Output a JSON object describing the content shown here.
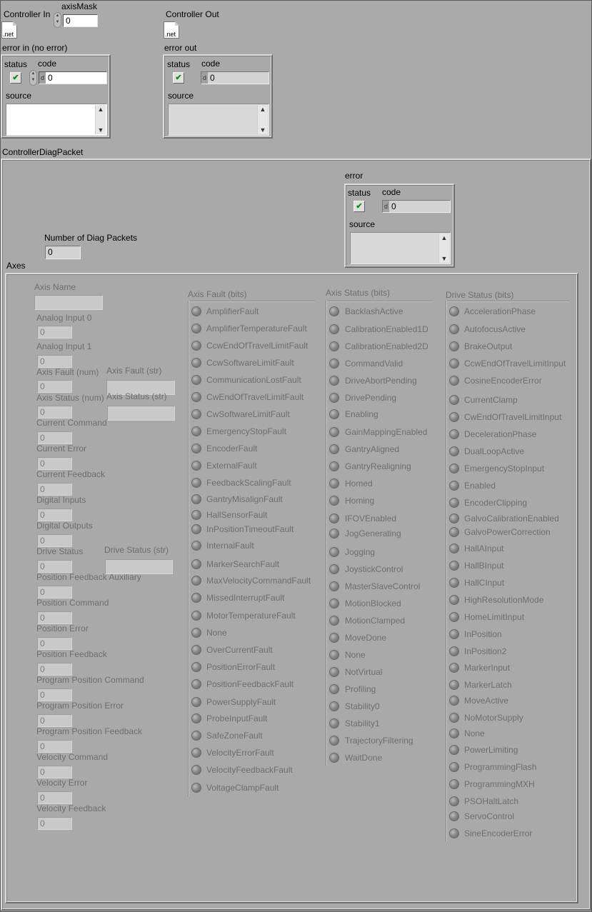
{
  "controller_in": {
    "label": "Controller In",
    "icon_text": ".net"
  },
  "axis_mask": {
    "label": "axisMask",
    "value": "0"
  },
  "controller_out": {
    "label": "Controller Out",
    "icon_text": ".net"
  },
  "error_in": {
    "title": "error in (no error)",
    "status_label": "status",
    "code_label": "code",
    "code_value": "0",
    "source_label": "source",
    "source_value": ""
  },
  "error_out": {
    "title": "error out",
    "status_label": "status",
    "code_label": "code",
    "code_value": "0",
    "source_label": "source",
    "source_value": ""
  },
  "packet": {
    "title": "ControllerDiagPacket",
    "error": {
      "title": "error",
      "status_label": "status",
      "code_label": "code",
      "code_value": "0",
      "source_label": "source",
      "source_value": ""
    },
    "num_packets": {
      "label": "Number of Diag Packets",
      "value": "0"
    },
    "axes_label": "Axes",
    "axis_name": {
      "label": "Axis Name",
      "value": ""
    },
    "numeric_fields": [
      {
        "label": "Analog Input 0",
        "value": "0"
      },
      {
        "label": "Analog Input 1",
        "value": "0"
      },
      {
        "label": "Axis Fault (num)",
        "value": "0"
      },
      {
        "label": "Axis Status (num)",
        "value": "0"
      },
      {
        "label": "Current Command",
        "value": "0"
      },
      {
        "label": "Current Error",
        "value": "0"
      },
      {
        "label": "Current Feedback",
        "value": "0"
      },
      {
        "label": "Digital Inputs",
        "value": "0"
      },
      {
        "label": "Digital Outputs",
        "value": "0"
      },
      {
        "label": "Drive Status",
        "value": "0"
      },
      {
        "label": "Position Feedback Auxiliary",
        "value": "0"
      },
      {
        "label": "Position Command",
        "value": "0"
      },
      {
        "label": "Position Error",
        "value": "0"
      },
      {
        "label": "Position Feedback",
        "value": "0"
      },
      {
        "label": "Program Position Command",
        "value": "0"
      },
      {
        "label": "Program Position Error",
        "value": "0"
      },
      {
        "label": "Program Position Feedback",
        "value": "0"
      },
      {
        "label": "Velocity Command",
        "value": "0"
      },
      {
        "label": "Velocity Error",
        "value": "0"
      },
      {
        "label": "Velocity Feedback",
        "value": "0"
      }
    ],
    "string_fields": [
      {
        "label": "Axis Fault (str)",
        "value": ""
      },
      {
        "label": "Axis Status (str)",
        "value": ""
      },
      {
        "label": "Drive Status (str)",
        "value": ""
      }
    ],
    "axis_fault": {
      "title": "Axis Fault (bits)",
      "items": [
        "AmplifierFault",
        "AmplifierTemperatureFault",
        "CcwEndOfTravelLimitFault",
        "CcwSoftwareLimitFault",
        "CommunicationLostFault",
        "CwEndOfTravelLimitFault",
        "CwSoftwareLimitFault",
        "EmergencyStopFault",
        "EncoderFault",
        "ExternalFault",
        "FeedbackScalingFault",
        "GantryMisalignFault",
        "HallSensorFault",
        "InPositionTimeoutFault",
        "InternalFault",
        "MarkerSearchFault",
        "MaxVelocityCommandFault",
        "MissedInterruptFault",
        "MotorTemperatureFault",
        "None",
        "OverCurrentFault",
        "PositionErrorFault",
        "PositionFeedbackFault",
        "PowerSupplyFault",
        "ProbeInputFault",
        "SafeZoneFault",
        "VelocityErrorFault",
        "VelocityFeedbackFault",
        "VoltageClampFault"
      ]
    },
    "axis_status": {
      "title": "Axis Status (bits)",
      "items": [
        "BacklashActive",
        "CalibrationEnabled1D",
        "CalibrationEnabled2D",
        "CommandValid",
        "DriveAbortPending",
        "DrivePending",
        "Enabling",
        "GainMappingEnabled",
        "GantryAligned",
        "GantryRealigning",
        "Homed",
        "Homing",
        "IFOVEnabled",
        "JogGenerating",
        "Jogging",
        "JoystickControl",
        "MasterSlaveControl",
        "MotionBlocked",
        "MotionClamped",
        "MoveDone",
        "None",
        "NotVirtual",
        "Profiling",
        "Stability0",
        "Stability1",
        "TrajectoryFiltering",
        "WaitDone"
      ]
    },
    "drive_status": {
      "title": "Drive Status (bits)",
      "items": [
        "AccelerationPhase",
        "AutofocusActive",
        "BrakeOutput",
        "CcwEndOfTravelLimitInput",
        "CosineEncoderError",
        "CurrentClamp",
        "CwEndOfTravelLimitInput",
        "DecelerationPhase",
        "DualLoopActive",
        "EmergencyStopInput",
        "Enabled",
        "EncoderClipping",
        "GalvoCalibrationEnabled",
        "GalvoPowerCorrection",
        "HallAInput",
        "HallBInput",
        "HallCInput",
        "HighResolutionMode",
        "HomeLimitInput",
        "InPosition",
        "InPosition2",
        "MarkerInput",
        "MarkerLatch",
        "MoveActive",
        "NoMotorSupply",
        "None",
        "PowerLimiting",
        "ProgrammingFlash",
        "ProgrammingMXH",
        "PSOHaltLatch",
        "ServoControl",
        "SineEncoderError"
      ]
    }
  }
}
